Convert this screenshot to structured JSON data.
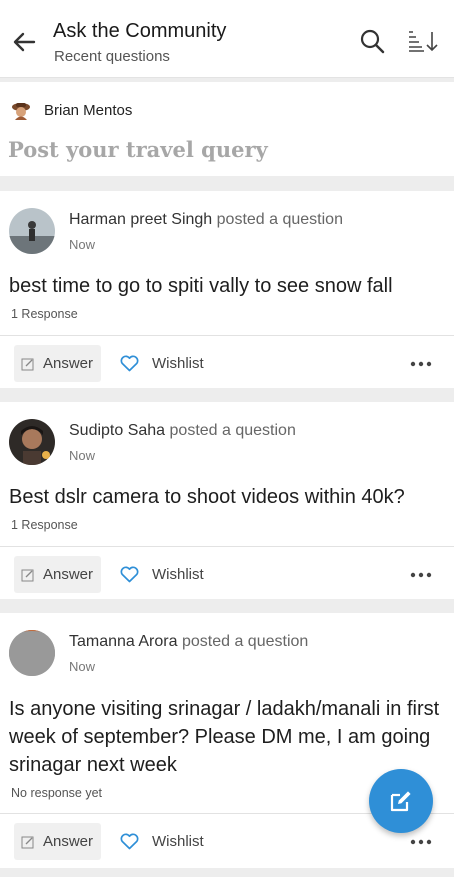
{
  "header": {
    "title": "Ask the Community",
    "subtitle": "Recent questions"
  },
  "composer": {
    "user_name": "Brian Mentos",
    "prompt": "Post your travel query"
  },
  "questions": [
    {
      "author": "Harman preet Singh",
      "action": "posted a question",
      "time": "Now",
      "text": "best time to go to spiti vally to see snow fall",
      "responses": "1 Response",
      "answer_label": "Answer",
      "wishlist_label": "Wishlist"
    },
    {
      "author": "Sudipto Saha",
      "action": "posted a question",
      "time": "Now",
      "text": "Best dslr camera to shoot videos within 40k?",
      "responses": "1 Response",
      "answer_label": "Answer",
      "wishlist_label": "Wishlist"
    },
    {
      "author": "Tamanna Arora",
      "action": "posted a question",
      "time": "Now",
      "text": "Is anyone visiting srinagar / ladakh/manali in first week of september? Please DM me, I am going srinagar next week",
      "responses": "No response yet",
      "answer_label": "Answer",
      "wishlist_label": "Wishlist"
    }
  ],
  "colors": {
    "accent": "#2f8fd7",
    "wishlist_icon": "#2f8fd7"
  }
}
